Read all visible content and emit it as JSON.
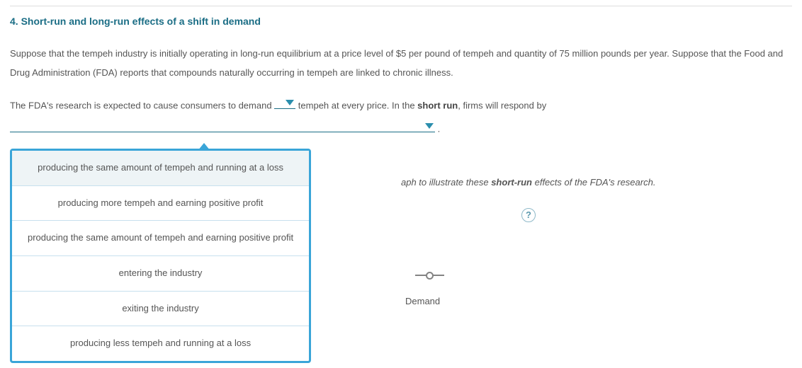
{
  "question": {
    "number": "4.",
    "title": "Short-run and long-run effects of a shift in demand"
  },
  "scenario": "Suppose that the tempeh industry is initially operating in long-run equilibrium at a price level of $5 per pound of tempeh and quantity of 75 million pounds per year. Suppose that the Food and Drug Administration (FDA) reports that compounds naturally occurring in tempeh are linked to chronic illness.",
  "sentence": {
    "part1": "The FDA's research is expected to cause consumers to demand ",
    "part2": " tempeh at every price. In the ",
    "bold_sr": "short run",
    "part3": ", firms will respond by",
    "period": " ."
  },
  "instructions": {
    "suffix": "aph to illustrate these ",
    "bold": "short-run",
    "tail": " effects of the FDA's research."
  },
  "dropdown2_options": [
    "producing the same amount of tempeh and running at a loss",
    "producing more tempeh and earning positive profit",
    "producing the same amount of tempeh and earning positive profit",
    "entering the industry",
    "exiting the industry",
    "producing less tempeh and running at a loss"
  ],
  "help_label": "?",
  "legend": {
    "demand": "Demand"
  }
}
